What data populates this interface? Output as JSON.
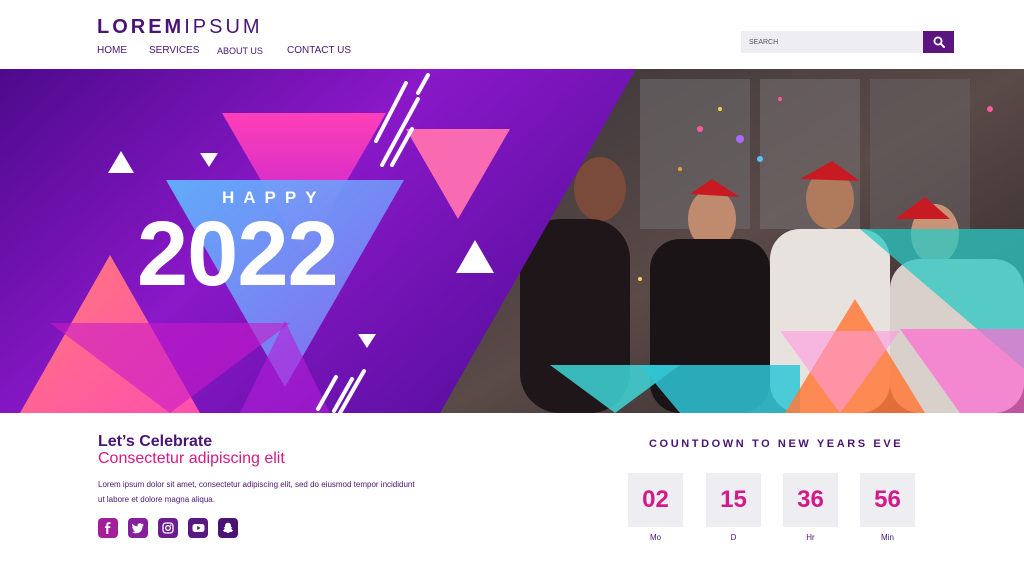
{
  "brand": {
    "logo_bold": "LOREM",
    "logo_light": "IPSUM"
  },
  "nav": [
    {
      "label": "HOME"
    },
    {
      "label": "SERVICES"
    },
    {
      "label": "ABOUT US"
    },
    {
      "label": "CONTACT US"
    }
  ],
  "search": {
    "placeholder": "SEARCH"
  },
  "hero": {
    "happy": "HAPPY",
    "year": "2022"
  },
  "intro": {
    "title": "Let’s Celebrate",
    "subtitle": "Consectetur adipiscing elit",
    "body": "Lorem ipsum dolor sit amet, consectetur adipiscing elit, sed do eiusmod tempor incididunt ut labore et dolore magna aliqua."
  },
  "socials": [
    {
      "icon": "facebook-icon",
      "color": "#a21f9a"
    },
    {
      "icon": "twitter-icon",
      "color": "#861f9c"
    },
    {
      "icon": "instagram-icon",
      "color": "#6c1e90"
    },
    {
      "icon": "youtube-icon",
      "color": "#57197f"
    },
    {
      "icon": "snapchat-icon",
      "color": "#4a1474"
    }
  ],
  "countdown": {
    "title": "COUNTDOWN TO NEW YEARS EVE",
    "items": [
      {
        "value": "02",
        "unit": "Mo"
      },
      {
        "value": "15",
        "unit": "D"
      },
      {
        "value": "36",
        "unit": "Hr"
      },
      {
        "value": "56",
        "unit": "Min"
      }
    ]
  },
  "colors": {
    "primary": "#4a1474",
    "accent": "#d21a8a",
    "box": "#eeeef2"
  }
}
